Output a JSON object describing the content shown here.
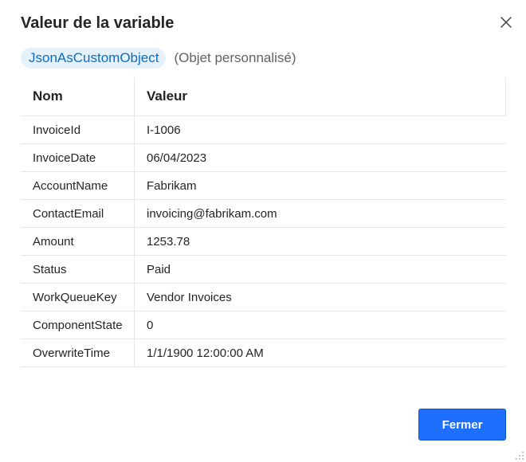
{
  "dialog": {
    "title": "Valeur de la variable",
    "close_icon": "close-icon"
  },
  "variable": {
    "name": "JsonAsCustomObject",
    "type": "(Objet personnalisé)"
  },
  "table": {
    "columns": [
      "Nom",
      "Valeur"
    ],
    "rows": [
      {
        "name": "InvoiceId",
        "value": "I-1006"
      },
      {
        "name": "InvoiceDate",
        "value": "06/04/2023"
      },
      {
        "name": "AccountName",
        "value": "Fabrikam"
      },
      {
        "name": "ContactEmail",
        "value": "invoicing@fabrikam.com"
      },
      {
        "name": "Amount",
        "value": "1253.78"
      },
      {
        "name": "Status",
        "value": "Paid"
      },
      {
        "name": "WorkQueueKey",
        "value": "Vendor Invoices"
      },
      {
        "name": "ComponentState",
        "value": "0"
      },
      {
        "name": "OverwriteTime",
        "value": "1/1/1900 12:00:00 AM"
      }
    ]
  },
  "footer": {
    "close_label": "Fermer"
  },
  "colors": {
    "accent": "#1f6fff",
    "pill_bg": "#e5f1fb",
    "pill_text": "#0f6cbd"
  }
}
